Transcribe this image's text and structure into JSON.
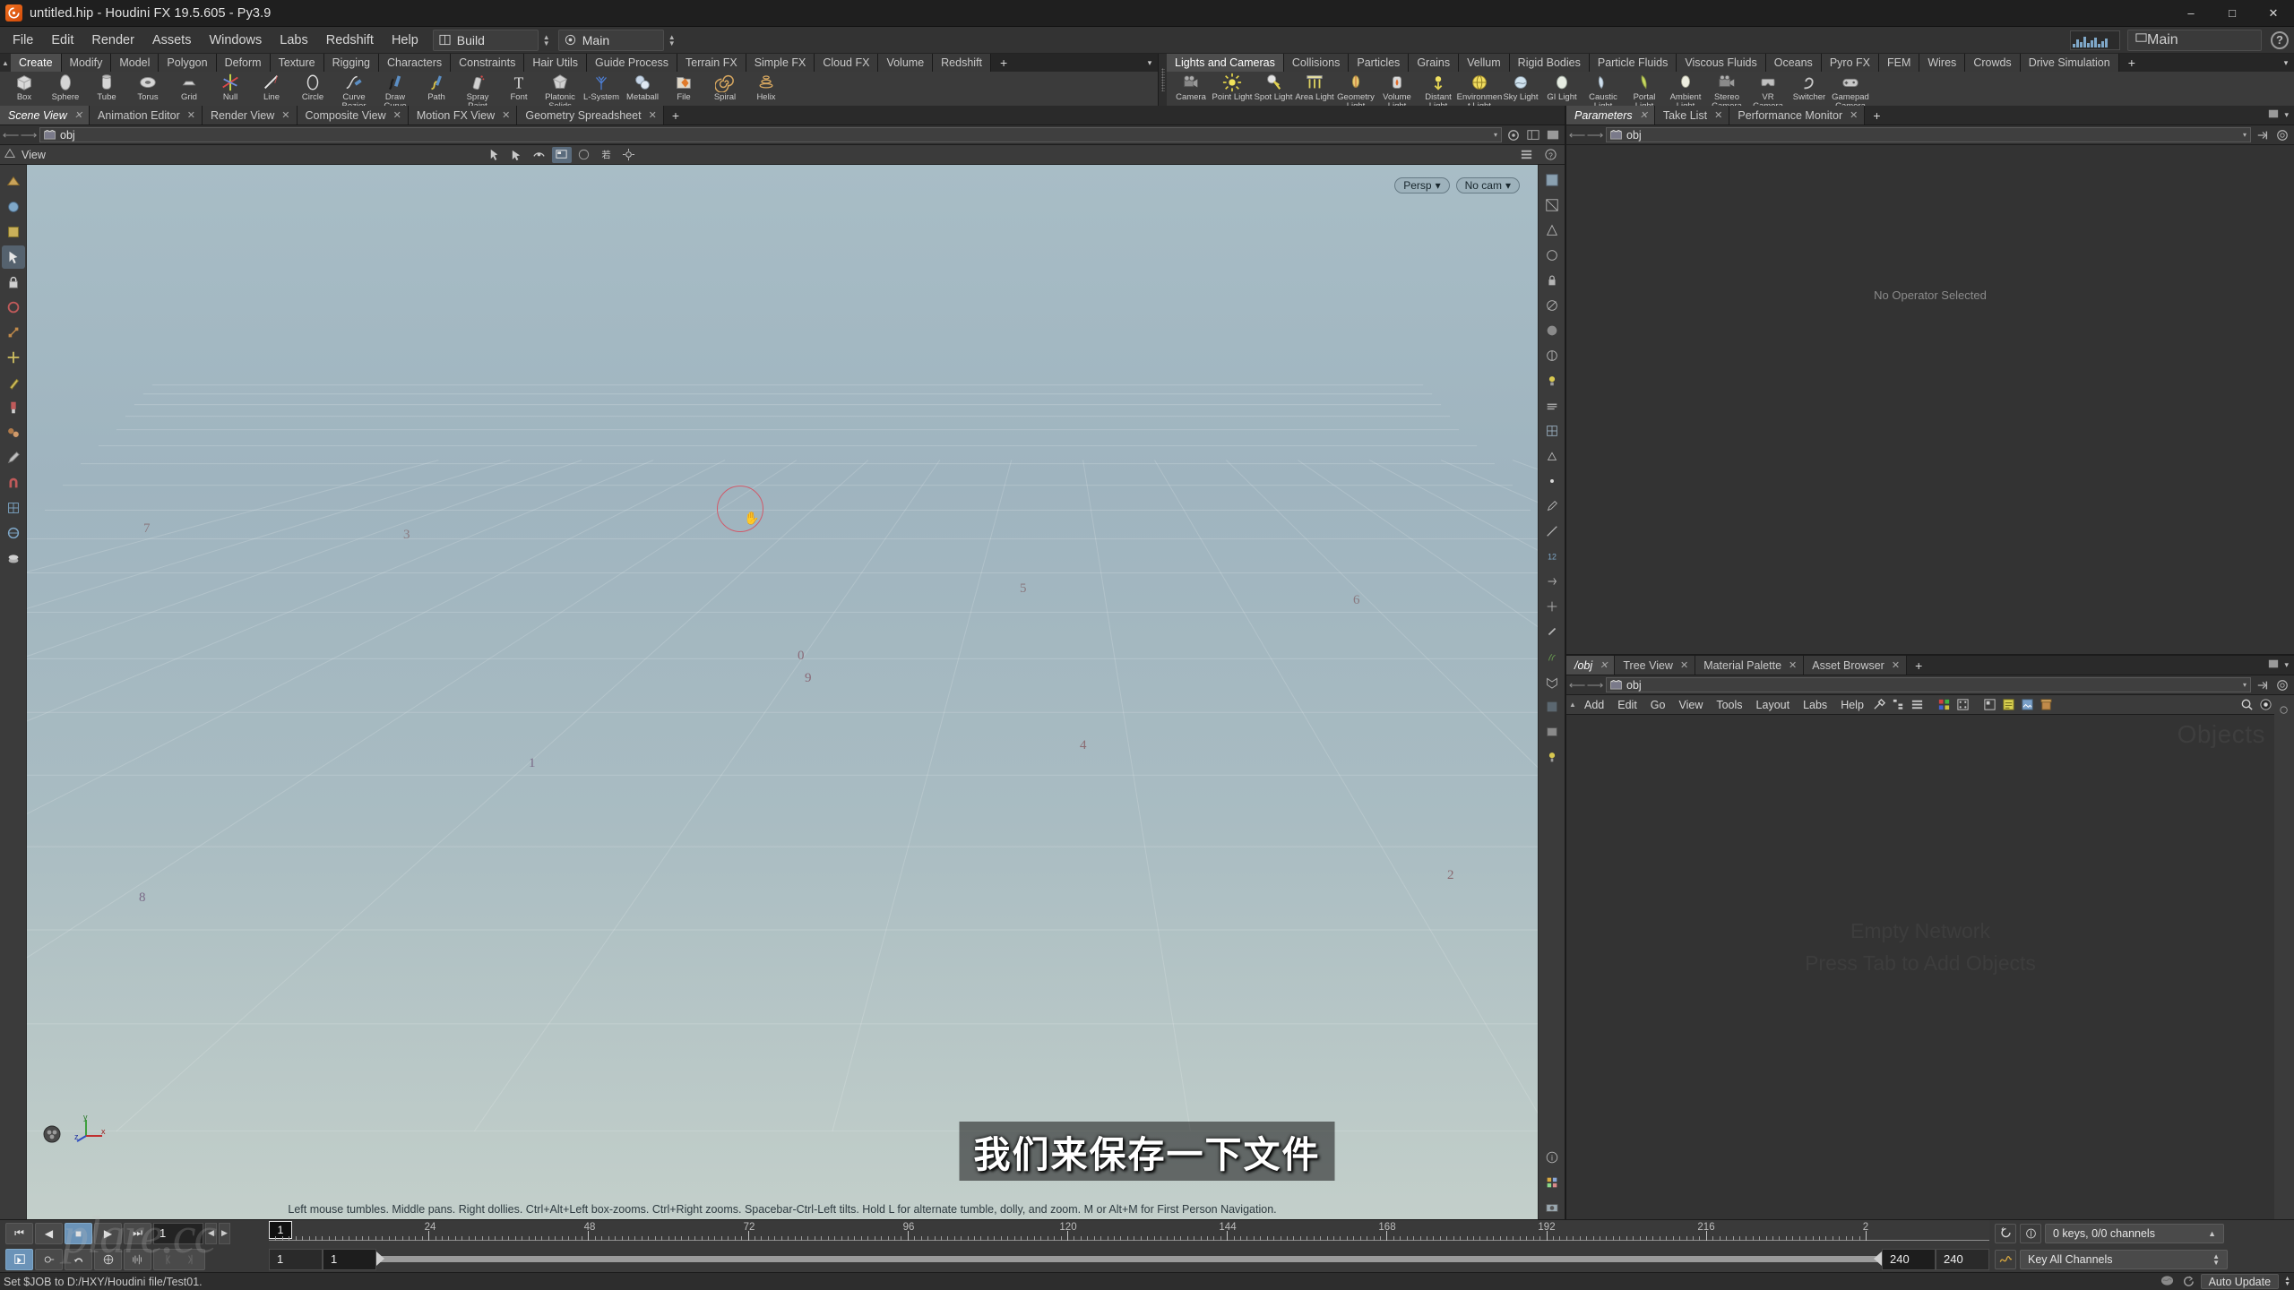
{
  "window": {
    "title": "untitled.hip - Houdini FX 19.5.605 - Py3.9",
    "app_icon": "houdini-logo-icon",
    "minimize": "–",
    "maximize": "□",
    "close": "✕"
  },
  "menubar": {
    "items": [
      "File",
      "Edit",
      "Render",
      "Assets",
      "Windows",
      "Labs",
      "Redshift",
      "Help"
    ],
    "desktop_label": "Build",
    "viewport_layout_label": "Main",
    "right_label": "Main",
    "help_glyph": "?"
  },
  "shelf_left": {
    "tabs": [
      "Create",
      "Modify",
      "Model",
      "Polygon",
      "Deform",
      "Texture",
      "Rigging",
      "Characters",
      "Constraints",
      "Hair Utils",
      "Guide Process",
      "Terrain FX",
      "Simple FX",
      "Cloud FX",
      "Volume",
      "Redshift"
    ],
    "active_tab": "Create",
    "add_tab": "+",
    "overflow_caret": "▾",
    "items": [
      {
        "label": "Box",
        "icon": "box-icon"
      },
      {
        "label": "Sphere",
        "icon": "sphere-icon"
      },
      {
        "label": "Tube",
        "icon": "tube-icon"
      },
      {
        "label": "Torus",
        "icon": "torus-icon"
      },
      {
        "label": "Grid",
        "icon": "grid-icon"
      },
      {
        "label": "Null",
        "icon": "null-icon"
      },
      {
        "label": "Line",
        "icon": "line-icon"
      },
      {
        "label": "Circle",
        "icon": "circle-icon"
      },
      {
        "label": "Curve Bezier",
        "icon": "curve-bezier-icon"
      },
      {
        "label": "Draw Curve",
        "icon": "draw-curve-icon"
      },
      {
        "label": "Path",
        "icon": "path-icon"
      },
      {
        "label": "Spray Paint",
        "icon": "spray-paint-icon"
      },
      {
        "label": "Font",
        "icon": "font-icon"
      },
      {
        "label": "Platonic Solids",
        "icon": "platonic-solids-icon"
      },
      {
        "label": "L-System",
        "icon": "l-system-icon"
      },
      {
        "label": "Metaball",
        "icon": "metaball-icon"
      },
      {
        "label": "File",
        "icon": "file-icon"
      },
      {
        "label": "Spiral",
        "icon": "spiral-icon"
      },
      {
        "label": "Helix",
        "icon": "helix-icon"
      }
    ]
  },
  "shelf_right": {
    "tabs": [
      "Lights and Cameras",
      "Collisions",
      "Particles",
      "Grains",
      "Vellum",
      "Rigid Bodies",
      "Particle Fluids",
      "Viscous Fluids",
      "Oceans",
      "Pyro FX",
      "FEM",
      "Wires",
      "Crowds",
      "Drive Simulation"
    ],
    "active_tab": "Lights and Cameras",
    "add_tab": "+",
    "overflow_caret": "▾",
    "items": [
      {
        "label": "Camera",
        "icon": "camera-icon"
      },
      {
        "label": "Point Light",
        "icon": "point-light-icon"
      },
      {
        "label": "Spot Light",
        "icon": "spot-light-icon"
      },
      {
        "label": "Area Light",
        "icon": "area-light-icon"
      },
      {
        "label": "Geometry Light",
        "icon": "geometry-light-icon"
      },
      {
        "label": "Volume Light",
        "icon": "volume-light-icon"
      },
      {
        "label": "Distant Light",
        "icon": "distant-light-icon"
      },
      {
        "label": "Environment Light",
        "icon": "environment-light-icon"
      },
      {
        "label": "Sky Light",
        "icon": "sky-light-icon"
      },
      {
        "label": "GI Light",
        "icon": "gi-light-icon"
      },
      {
        "label": "Caustic Light",
        "icon": "caustic-light-icon"
      },
      {
        "label": "Portal Light",
        "icon": "portal-light-icon"
      },
      {
        "label": "Ambient Light",
        "icon": "ambient-light-icon"
      },
      {
        "label": "Stereo Camera",
        "icon": "stereo-camera-icon"
      },
      {
        "label": "VR Camera",
        "icon": "vr-camera-icon"
      },
      {
        "label": "Switcher",
        "icon": "switcher-icon"
      },
      {
        "label": "Gamepad Camera",
        "icon": "gamepad-camera-icon"
      }
    ]
  },
  "scene_pane": {
    "tabs": [
      "Scene View",
      "Animation Editor",
      "Render View",
      "Composite View",
      "Motion FX View",
      "Geometry Spreadsheet"
    ],
    "active_tab": "Scene View",
    "add_tab": "+",
    "close_glyph": "✕",
    "path_value": "obj",
    "path_caret": "▾",
    "viewport_label": "View",
    "view_mode": "Persp",
    "camera_mode": "No cam",
    "hint": "Left mouse tumbles. Middle pans. Right dollies. Ctrl+Alt+Left box-zooms. Ctrl+Right zooms. Spacebar-Ctrl-Left tilts. Hold L for alternate tumble, dolly, and zoom.    M or Alt+M for First Person Navigation.",
    "axis_x": "x",
    "axis_y": "y",
    "axis_z": "z",
    "floor_numbers": [
      "0",
      "1",
      "2",
      "3",
      "4",
      "5",
      "6",
      "7",
      "8",
      "9"
    ]
  },
  "parameters_pane": {
    "tabs": [
      "Parameters",
      "Take List",
      "Performance Monitor"
    ],
    "active_tab": "Parameters",
    "add_tab": "+",
    "path_value": "obj",
    "empty_message": "No Operator Selected"
  },
  "network_pane": {
    "tabs": [
      "/obj",
      "Tree View",
      "Material Palette",
      "Asset Browser"
    ],
    "active_tab": "/obj",
    "add_tab": "+",
    "path_value": "obj",
    "menu": [
      "Add",
      "Edit",
      "Go",
      "View",
      "Tools",
      "Layout",
      "Labs",
      "Help"
    ],
    "empty_title": "Empty Network",
    "empty_subtitle": "Press Tab to Add Objects",
    "context_label": "Objects"
  },
  "playbar": {
    "current_frame": "1",
    "start_frame": "1",
    "range_start": "1",
    "range_end": "240",
    "global_end": "240",
    "playhead_frame": "1",
    "ruler_labels": [
      "24",
      "48",
      "72",
      "96",
      "120",
      "144",
      "168",
      "192",
      "216",
      "2"
    ],
    "keys_status": "0 keys, 0/0 channels",
    "key_mode": "Key All Channels",
    "transport": {
      "jump_start": "⏮",
      "step_back": "◀",
      "stop": "■",
      "play": "▶",
      "jump_end": "⏭"
    }
  },
  "statusbar": {
    "message": "Set $JOB to D:/HXY/Houdini file/Test01.",
    "auto_update": "Auto Update"
  },
  "overlay": {
    "subtitle": "我们来保存一下文件",
    "watermark": "plare.cc"
  },
  "colors": {
    "accent_blue": "#6b93b8",
    "shelf_bg": "#3b3b3b",
    "panel_bg": "#333333",
    "viewport_top": "#a8bdc6",
    "viewport_bottom": "#c3cfca",
    "cursor_ring": "#d05a6a"
  }
}
